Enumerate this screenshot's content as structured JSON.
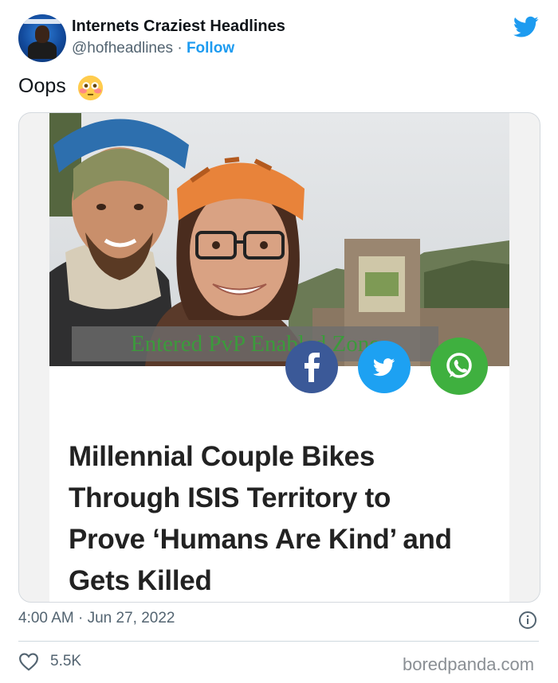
{
  "author": {
    "display_name": "Internets Craziest Headlines",
    "handle": "@hofheadlines",
    "separator": "·",
    "follow_label": "Follow",
    "avatar_icon": "profile-avatar",
    "brand_icon": "twitter-bird-icon"
  },
  "tweet": {
    "text": "Oops",
    "emoji_icon": "flushed-face-emoji",
    "timestamp": "4:00 AM · Jun 27, 2022",
    "info_icon": "info-circle-icon"
  },
  "media": {
    "overlay_text": "Entered PvP Enabled Zone",
    "share_buttons": [
      {
        "network": "facebook",
        "icon": "facebook-icon",
        "color": "#3b5998"
      },
      {
        "network": "twitter",
        "icon": "twitter-icon",
        "color": "#1da1f2"
      },
      {
        "network": "whatsapp",
        "icon": "whatsapp-icon",
        "color": "#3fb03f"
      }
    ],
    "headline_lines": [
      "Millennial Couple Bikes",
      "Through ISIS Territory to",
      "Prove ‘Humans Are Kind’ and",
      "Gets Killed"
    ]
  },
  "engagement": {
    "likes": "5.5K",
    "like_icon": "heart-icon"
  },
  "watermark": "boredpanda.com",
  "colors": {
    "accent": "#1d9bf0",
    "text_primary": "#0f1419",
    "text_secondary": "#536471"
  }
}
